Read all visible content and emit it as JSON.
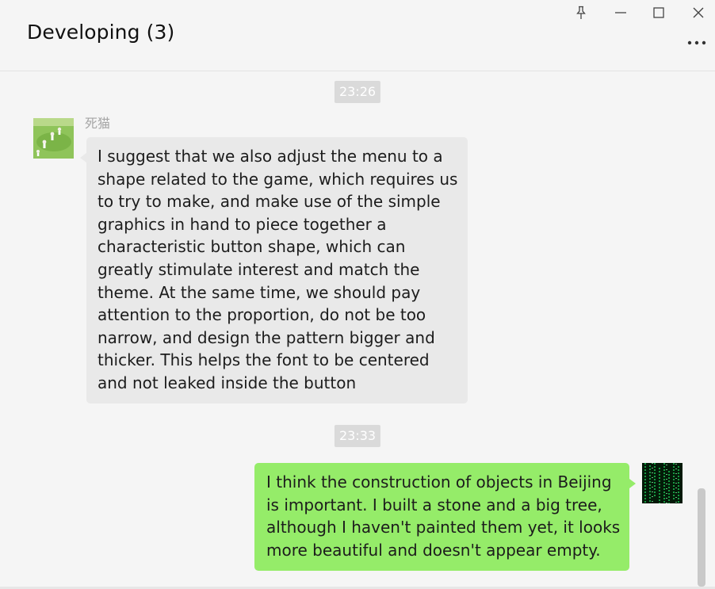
{
  "window": {
    "title": "Developing (3)",
    "controls": {
      "pin": "pin-icon",
      "minimize": "minimize-icon",
      "maximize": "maximize-icon",
      "close": "close-icon",
      "more": "more-icon"
    }
  },
  "messages": [
    {
      "time": "23:26",
      "direction": "incoming",
      "sender": "死猫",
      "avatar": "meadow-photo-avatar",
      "text": "I suggest that we also adjust the menu to a shape related to the game, which requires us to try to make, and make use of the simple graphics in hand to piece together a characteristic button shape, which can greatly stimulate interest and match the theme. At the same time, we should pay attention to the proportion, do not be too narrow, and design the pattern bigger and thicker. This helps the font to be centered and not leaked inside the button",
      "bubble_color": "#e9e9e9"
    },
    {
      "time": "23:33",
      "direction": "outgoing",
      "avatar": "matrix-code-avatar",
      "text": "I think the construction of objects in Beijing is important. I built a stone and a big tree, although I haven't painted them yet, it looks more beautiful and doesn't appear empty.",
      "bubble_color": "#95ec69"
    }
  ],
  "colors": {
    "background": "#f5f5f5",
    "time_badge": "#dadada",
    "sender_name": "#a5a5a5"
  }
}
